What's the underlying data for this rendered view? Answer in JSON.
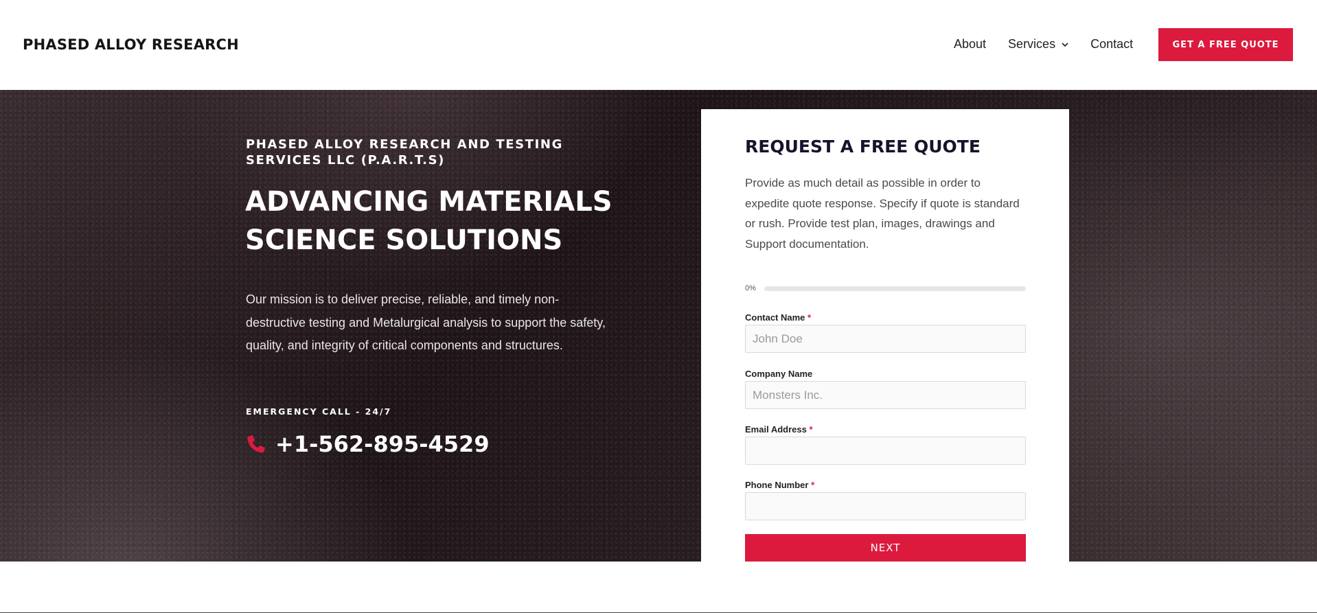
{
  "header": {
    "logo": "PHASED ALLOY RESEARCH",
    "nav": {
      "about": "About",
      "services": "Services",
      "contact": "Contact"
    },
    "cta": "GET A FREE QUOTE"
  },
  "hero": {
    "eyebrow": "PHASED ALLOY RESEARCH AND TESTING SERVICES LLC (P.A.R.T.S)",
    "headline": "ADVANCING MATERIALS SCIENCE SOLUTIONS",
    "mission": "Our mission is to deliver precise, reliable, and timely non-destructive testing and Metalurgical analysis to support the safety, quality, and integrity of critical components and structures.",
    "emergency_label": "EMERGENCY CALL - 24/7",
    "phone": "+1-562-895-4529",
    "phone_icon": "phone-icon"
  },
  "form": {
    "title": "REQUEST A FREE QUOTE",
    "description": "Provide as much detail as possible in order to expedite quote response. Specify if quote is standard or rush. Provide test plan, images, drawings and Support documentation.",
    "progress_label": "0%",
    "progress_value": 0,
    "fields": {
      "contact_name": {
        "label": "Contact Name",
        "required_mark": "*",
        "placeholder": "John Doe",
        "value": ""
      },
      "company_name": {
        "label": "Company Name",
        "placeholder": "Monsters Inc.",
        "value": ""
      },
      "email": {
        "label": "Email Address",
        "required_mark": "*",
        "placeholder": "",
        "value": ""
      },
      "phone": {
        "label": "Phone Number",
        "required_mark": "*",
        "placeholder": "",
        "value": ""
      }
    },
    "next_button": "NEXT"
  },
  "colors": {
    "accent": "#dc1a3e",
    "hero_dark": "#1f1518",
    "title_navy": "#14142b"
  }
}
